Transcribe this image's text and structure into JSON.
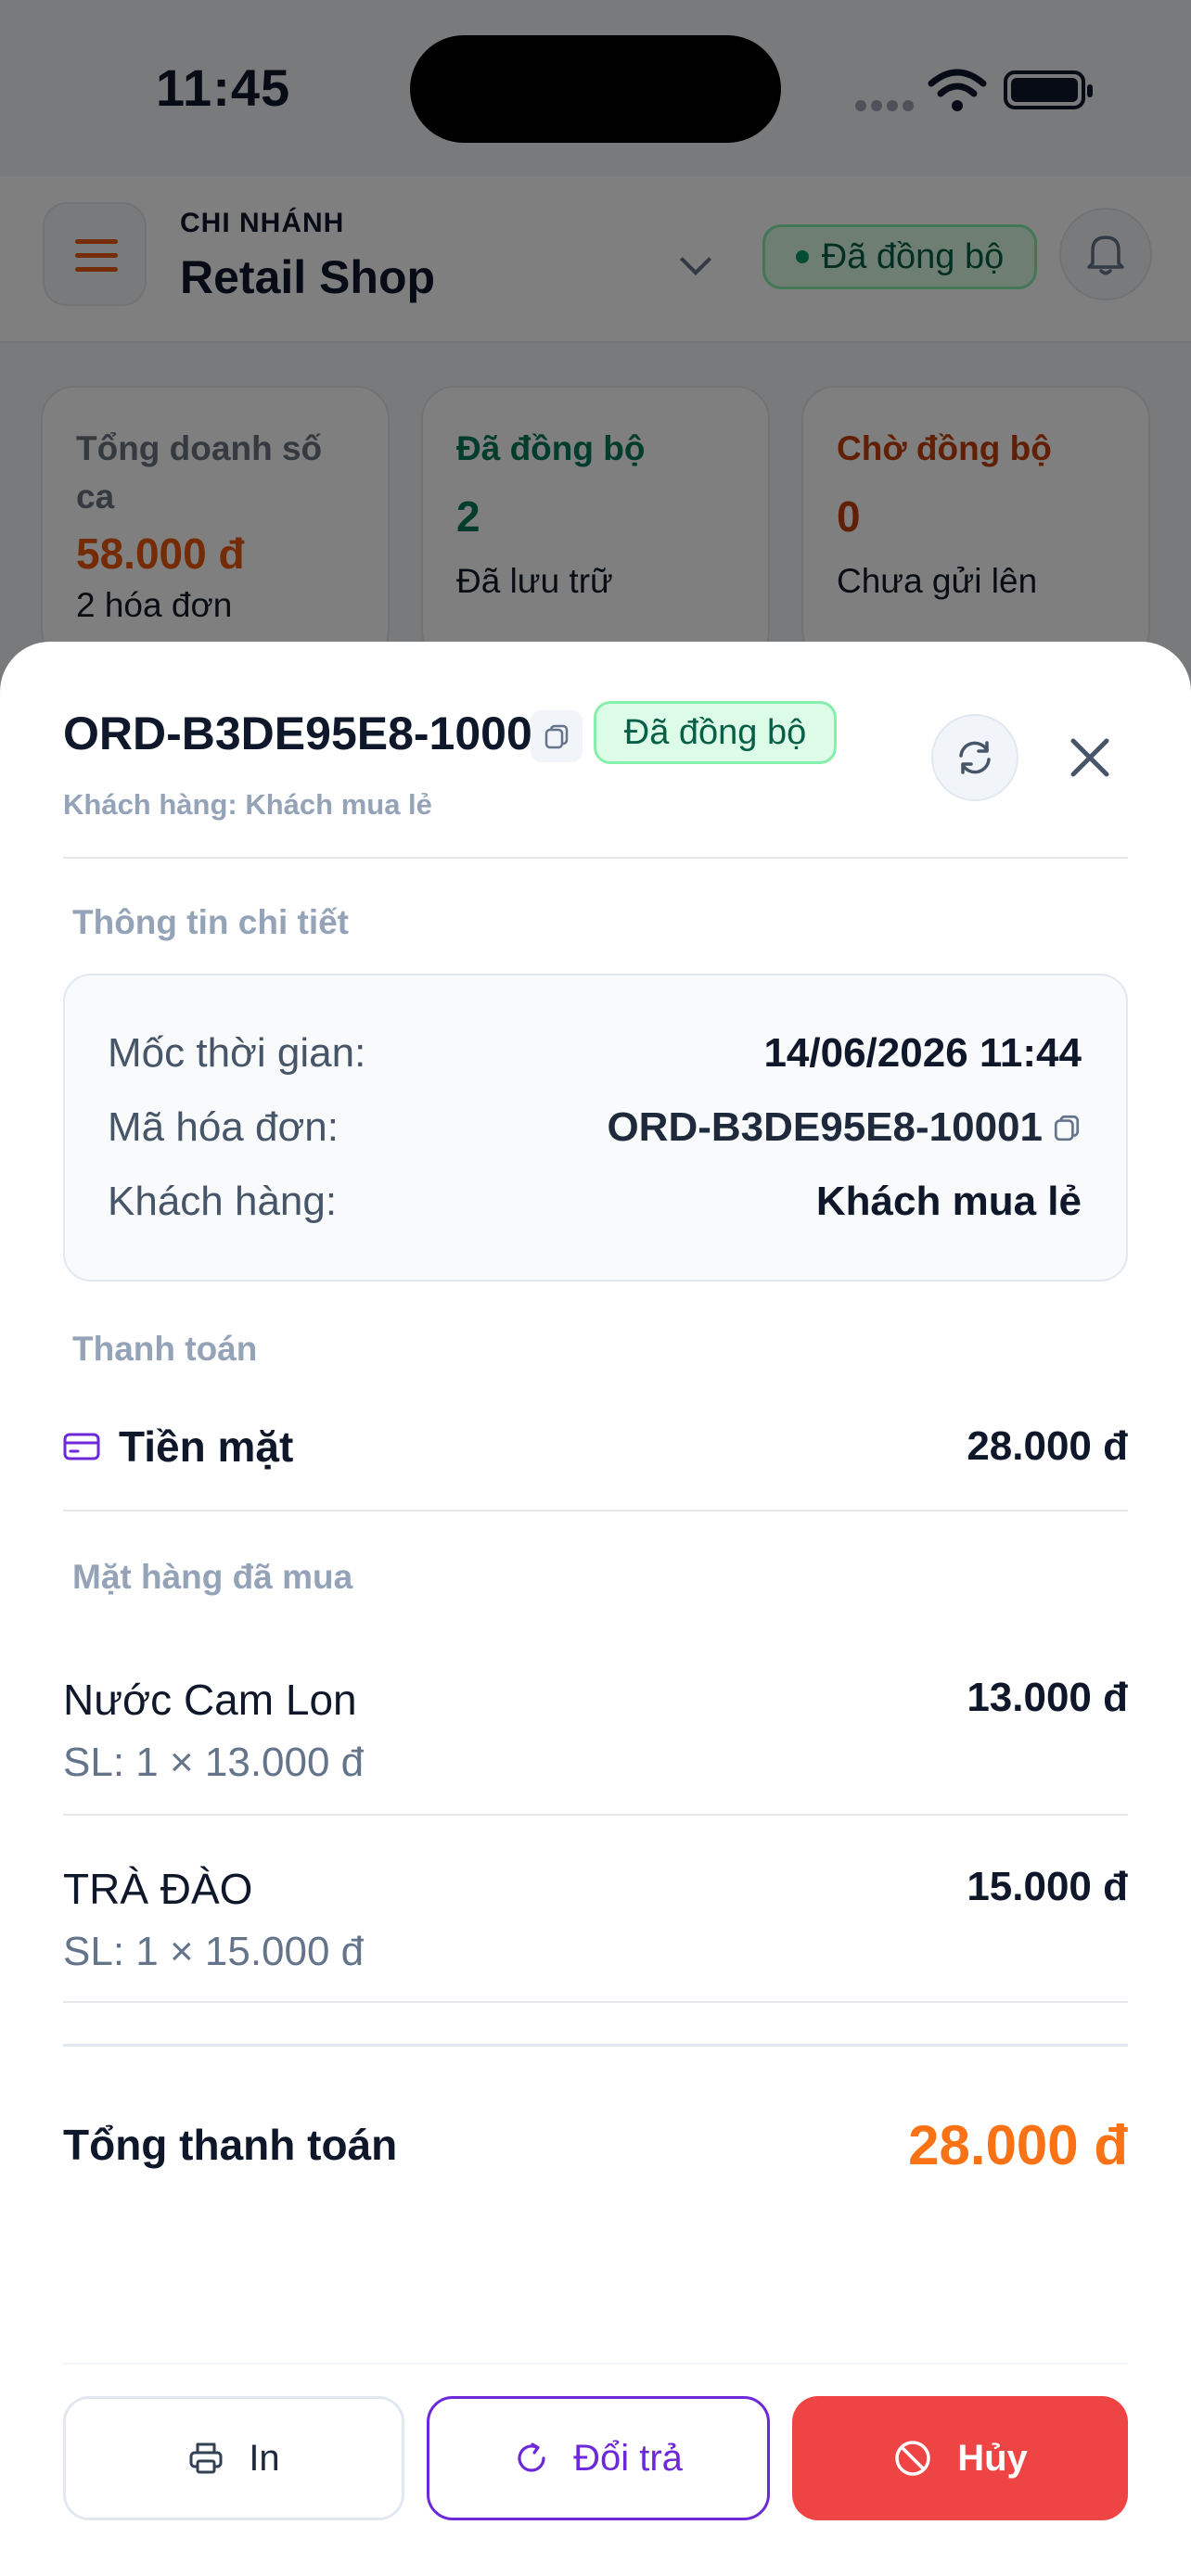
{
  "status_bar": {
    "time": "11:45"
  },
  "header": {
    "branch_caption": "CHI NHÁNH",
    "branch_name": "Retail Shop",
    "sync_status": "Đã đồng bộ"
  },
  "stats": [
    {
      "label": "Tổng doanh số ca",
      "value": "58.000 đ",
      "sub": "2 hóa đơn",
      "color": "#ea580c"
    },
    {
      "label": "Đã đồng bộ",
      "value": "2",
      "sub": "Đã lưu trữ",
      "color": "#047857"
    },
    {
      "label": "Chờ đồng bộ",
      "value": "0",
      "sub": "Chưa gửi lên",
      "color": "#c2410c"
    }
  ],
  "sheet": {
    "order_id": "ORD-B3DE95E8-10001",
    "badge": "Đã đồng bộ",
    "customer_line": "Khách hàng: Khách mua lẻ",
    "details_title": "Thông tin chi tiết",
    "details": [
      {
        "key": "Mốc thời gian:",
        "value": "14/06/2026 11:44"
      },
      {
        "key": "Mã hóa đơn:",
        "value": "ORD-B3DE95E8-10001"
      },
      {
        "key": "Khách hàng:",
        "value": "Khách mua lẻ"
      }
    ],
    "payment_title": "Thanh toán",
    "payment": {
      "method": "Tiền mặt",
      "amount": "28.000 đ",
      "icon": "card-icon"
    },
    "items_title": "Mặt hàng đã mua",
    "items": [
      {
        "name": "Nước Cam Lon",
        "qty": "SL: 1 × 13.000 đ",
        "price": "13.000 đ"
      },
      {
        "name": "TRÀ ĐÀO",
        "qty": "SL: 1 × 15.000 đ",
        "price": "15.000 đ"
      }
    ],
    "total_label": "Tổng thanh toán",
    "total_amount": "28.000 đ",
    "actions": {
      "print": "In",
      "return": "Đổi trả",
      "cancel": "Hủy"
    }
  },
  "colors": {
    "accent_orange": "#f97316",
    "purple": "#6d28d9",
    "danger": "#ef4444",
    "success": "#059669"
  }
}
